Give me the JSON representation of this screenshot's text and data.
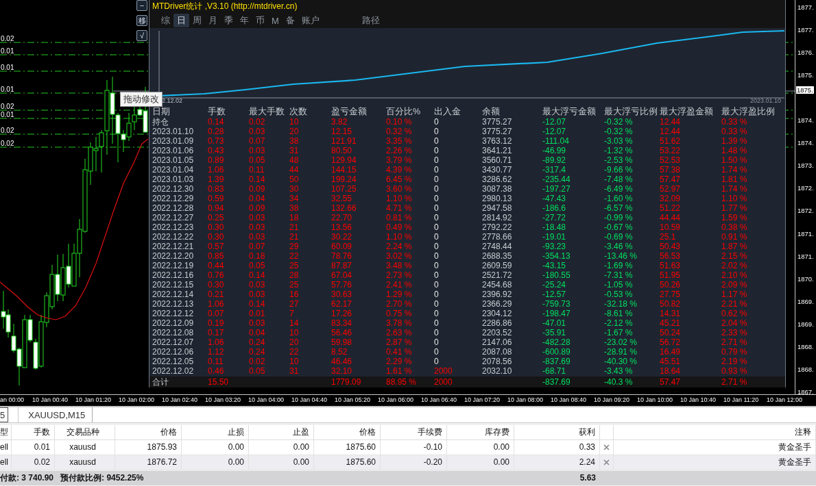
{
  "chart": {
    "level_labels": [
      "0.02",
      "0.01",
      "0.01",
      "0.01",
      "0.02",
      "0.01",
      "0.02",
      "0.02"
    ],
    "price_labels": [
      "1877.",
      "1877.",
      "1876.",
      "1875.",
      "1874.",
      "1874.",
      "1873.",
      "1872.",
      "1872.",
      "1871.",
      "1871.",
      "1870.",
      "1869.",
      "1869.",
      "1868.",
      "1868.",
      "1867."
    ],
    "current_price": "1875.",
    "time_labels": [
      "an 00:00",
      "10 Jan 00:40",
      "10 Jan 01:20",
      "10 Jan 02:00",
      "10 Jan 02:40",
      "10 Jan 03:20",
      "10 Jan 04:00",
      "10 Jan 04:40",
      "10 Jan 05:20",
      "10 Jan 06:00",
      "10 Jan 06:40",
      "10 Jan 07:20",
      "10 Jan 08:00",
      "10 Jan 08:40",
      "10 Jan 09:20",
      "10 Jan 10:00",
      "10 Jan 10:40",
      "10 Jan 11:20",
      "10 Jan 12:00"
    ],
    "side_buttons": [
      "−",
      "移",
      "√"
    ],
    "tooltip": "拖动修改"
  },
  "stats_panel": {
    "title": "MTDriver统计 ,V3.10 (http://mtdriver.cn)",
    "tabs": [
      {
        "label": "综",
        "selected": false
      },
      {
        "label": "日",
        "selected": true
      },
      {
        "label": "周",
        "selected": false
      },
      {
        "label": "月",
        "selected": false
      },
      {
        "label": "季",
        "selected": false
      },
      {
        "label": "年",
        "selected": false
      },
      {
        "label": "币",
        "selected": false
      },
      {
        "label": "M",
        "selected": false
      },
      {
        "label": "备",
        "selected": false
      },
      {
        "label": "账户",
        "selected": false
      },
      {
        "label": "路径",
        "selected": false
      }
    ],
    "equity_start": "2.12.02",
    "equity_end": "2023.01.10",
    "columns": [
      {
        "label": "日期",
        "color": "#c8ccd2"
      },
      {
        "label": "手数",
        "color": "#ff0000"
      },
      {
        "label": "最大手数",
        "color": "#ff0000"
      },
      {
        "label": "次数",
        "color": "#ff0000"
      },
      {
        "label": "盈亏金额",
        "color": "#ff0000"
      },
      {
        "label": "百分比%",
        "color": "#ff0000"
      },
      {
        "label": "出入金",
        "color": "#e8e8e8"
      },
      {
        "label": "余额",
        "color": "#c8ccd2"
      },
      {
        "label": "最大浮亏金额",
        "color": "#00e060"
      },
      {
        "label": "最大浮亏比例",
        "color": "#00e060"
      },
      {
        "label": "最大浮盈金额",
        "color": "#ff0000"
      },
      {
        "label": "最大浮盈比例",
        "color": "#ff0000"
      }
    ],
    "rows": [
      {
        "deposit": false,
        "cells": [
          "持仓",
          "0.14",
          "0.02",
          "10",
          "3.82",
          "0.10 %",
          "0",
          "3775.27",
          "-12.07",
          "-0.32 %",
          "12.44",
          "0.33 %"
        ]
      },
      {
        "deposit": false,
        "cells": [
          "2023.01.10",
          "0.28",
          "0.03",
          "20",
          "12.15",
          "0.32 %",
          "0",
          "3775.27",
          "-12.07",
          "-0.32 %",
          "12.44",
          "0.33 %"
        ]
      },
      {
        "deposit": false,
        "cells": [
          "2023.01.09",
          "0.73",
          "0.07",
          "38",
          "121.91",
          "3.35 %",
          "0",
          "3763.12",
          "-111.04",
          "-3.03 %",
          "51.62",
          "1.39 %"
        ]
      },
      {
        "deposit": false,
        "cells": [
          "2023.01.06",
          "0.43",
          "0.03",
          "31",
          "80.50",
          "2.26 %",
          "0",
          "3641.21",
          "-46.99",
          "-1.32 %",
          "53.22",
          "1.48 %"
        ]
      },
      {
        "deposit": false,
        "cells": [
          "2023.01.05",
          "0.89",
          "0.05",
          "48",
          "129.94",
          "3.79 %",
          "0",
          "3560.71",
          "-89.92",
          "-2.53 %",
          "52.53",
          "1.50 %"
        ]
      },
      {
        "deposit": false,
        "cells": [
          "2023.01.04",
          "1.06",
          "0.11",
          "44",
          "144.15",
          "4.39 %",
          "0",
          "3430.77",
          "-317.4",
          "-9.66 %",
          "57.38",
          "1.74 %"
        ]
      },
      {
        "deposit": false,
        "cells": [
          "2023.01.03",
          "1.39",
          "0.14",
          "50",
          "199.24",
          "6.45 %",
          "0",
          "3286.62",
          "-235.44",
          "-7.48 %",
          "57.47",
          "1.81 %"
        ]
      },
      {
        "deposit": false,
        "cells": [
          "2022.12.30",
          "0.83",
          "0.09",
          "30",
          "107.25",
          "3.60 %",
          "0",
          "3087.38",
          "-197.27",
          "-6.49 %",
          "52.97",
          "1.74 %"
        ]
      },
      {
        "deposit": false,
        "cells": [
          "2022.12.29",
          "0.59",
          "0.04",
          "34",
          "32.55",
          "1.10 %",
          "0",
          "2980.13",
          "-47.43",
          "-1.60 %",
          "32.09",
          "1.10 %"
        ]
      },
      {
        "deposit": false,
        "cells": [
          "2022.12.28",
          "0.94",
          "0.09",
          "38",
          "132.66",
          "4.71 %",
          "0",
          "2947.58",
          "-186.6",
          "-6.57 %",
          "51.22",
          "1.77 %"
        ]
      },
      {
        "deposit": false,
        "cells": [
          "2022.12.27",
          "0.25",
          "0.03",
          "18",
          "22.70",
          "0.81 %",
          "0",
          "2814.92",
          "-27.72",
          "-0.99 %",
          "44.44",
          "1.59 %"
        ]
      },
      {
        "deposit": false,
        "cells": [
          "2022.12.23",
          "0.30",
          "0.03",
          "21",
          "13.56",
          "0.49 %",
          "0",
          "2792.22",
          "-18.48",
          "-0.67 %",
          "10.59",
          "0.38 %"
        ]
      },
      {
        "deposit": false,
        "cells": [
          "2022.12.22",
          "0.30",
          "0.03",
          "21",
          "30.22",
          "1.10 %",
          "0",
          "2778.66",
          "-19.01",
          "-0.69 %",
          "25.1",
          "0.91 %"
        ]
      },
      {
        "deposit": false,
        "cells": [
          "2022.12.21",
          "0.57",
          "0.07",
          "29",
          "60.09",
          "2.24 %",
          "0",
          "2748.44",
          "-93.23",
          "-3.46 %",
          "50.43",
          "1.87 %"
        ]
      },
      {
        "deposit": false,
        "cells": [
          "2022.12.20",
          "0.85",
          "0.18",
          "22",
          "78.76",
          "3.02 %",
          "0",
          "2688.35",
          "-354.13",
          "-13.46 %",
          "56.53",
          "2.15 %"
        ]
      },
      {
        "deposit": false,
        "cells": [
          "2022.12.19",
          "0.44",
          "0.05",
          "25",
          "87.87",
          "3.48 %",
          "0",
          "2609.59",
          "-43.15",
          "-1.69 %",
          "51.63",
          "2.02 %"
        ]
      },
      {
        "deposit": false,
        "cells": [
          "2022.12.16",
          "0.76",
          "0.14",
          "28",
          "67.04",
          "2.73 %",
          "0",
          "2521.72",
          "-180.55",
          "-7.31 %",
          "51.95",
          "2.10 %"
        ]
      },
      {
        "deposit": false,
        "cells": [
          "2022.12.15",
          "0.30",
          "0.03",
          "25",
          "57.76",
          "2.41 %",
          "0",
          "2454.68",
          "-25.24",
          "-1.05 %",
          "50.26",
          "2.09 %"
        ]
      },
      {
        "deposit": false,
        "cells": [
          "2022.12.14",
          "0.21",
          "0.03",
          "16",
          "30.63",
          "1.29 %",
          "0",
          "2396.92",
          "-12.57",
          "-0.53 %",
          "27.75",
          "1.17 %"
        ]
      },
      {
        "deposit": false,
        "cells": [
          "2022.12.13",
          "1.06",
          "0.14",
          "27",
          "62.17",
          "2.70 %",
          "0",
          "2366.29",
          "-759.73",
          "-32.18 %",
          "50.82",
          "2.21 %"
        ]
      },
      {
        "deposit": false,
        "cells": [
          "2022.12.12",
          "0.07",
          "0.01",
          "7",
          "17.26",
          "0.75 %",
          "0",
          "2304.12",
          "-198.47",
          "-8.61 %",
          "14.31",
          "0.62 %"
        ]
      },
      {
        "deposit": false,
        "cells": [
          "2022.12.09",
          "0.19",
          "0.03",
          "14",
          "83.34",
          "3.78 %",
          "0",
          "2286.86",
          "-47.01",
          "-2.12 %",
          "45.21",
          "2.04 %"
        ]
      },
      {
        "deposit": false,
        "cells": [
          "2022.12.08",
          "0.17",
          "0.04",
          "10",
          "56.46",
          "2.63 %",
          "0",
          "2203.52",
          "-35.91",
          "-1.67 %",
          "50.24",
          "2.33 %"
        ]
      },
      {
        "deposit": false,
        "cells": [
          "2022.12.07",
          "1.06",
          "0.24",
          "20",
          "59.98",
          "2.87 %",
          "0",
          "2147.06",
          "-482.28",
          "-23.02 %",
          "56.72",
          "2.71 %"
        ]
      },
      {
        "deposit": false,
        "cells": [
          "2022.12.06",
          "1.12",
          "0.24",
          "22",
          "8.52",
          "0.41 %",
          "0",
          "2087.08",
          "-600.89",
          "-28.91 %",
          "16.49",
          "0.79 %"
        ]
      },
      {
        "deposit": false,
        "cells": [
          "2022.12.05",
          "0.11",
          "0.02",
          "10",
          "46.46",
          "2.29 %",
          "0",
          "2078.56",
          "-837.69",
          "-40.30 %",
          "45.51",
          "2.19 %"
        ]
      },
      {
        "deposit": true,
        "cells": [
          "2022.12.02",
          "0.46",
          "0.05",
          "31",
          "32.10",
          "1.61 %",
          "2000",
          "2032.10",
          "-68.71",
          "-3.43 %",
          "18.64",
          "0.93 %"
        ]
      }
    ],
    "total": {
      "deposit": true,
      "cells": [
        "合计",
        "15.50",
        null,
        null,
        "1779.09",
        "88.95 %",
        "2000",
        null,
        "-837.69",
        "-40.3 %",
        "57.47",
        "2.71 %"
      ]
    }
  },
  "terminal": {
    "tabs": [
      {
        "label": "5",
        "selected": true
      },
      {
        "label": "XAUUSD,M15",
        "selected": false
      }
    ],
    "columns": [
      "型",
      "手数",
      "交易品种",
      "价格",
      "止损",
      "止盈",
      "价格",
      "手续费",
      "库存费",
      "获利",
      null,
      "注释"
    ],
    "rows": [
      {
        "closable": true,
        "cells": [
          "ell",
          "0.01",
          "xauusd",
          "1875.93",
          "0.00",
          "0.00",
          "1875.60",
          "-0.10",
          "0.00",
          "0.33",
          null,
          "黄金圣手"
        ]
      },
      {
        "closable": true,
        "cells": [
          "ell",
          "0.02",
          "xauusd",
          "1876.72",
          "0.00",
          "0.00",
          "1875.60",
          "-0.20",
          "0.00",
          "2.24",
          null,
          "黄金圣手"
        ]
      }
    ],
    "footer": {
      "balance": "付款: 3 740.90",
      "margin_level": "预付款比例: 9452.25%",
      "profit": "5.63"
    }
  }
}
